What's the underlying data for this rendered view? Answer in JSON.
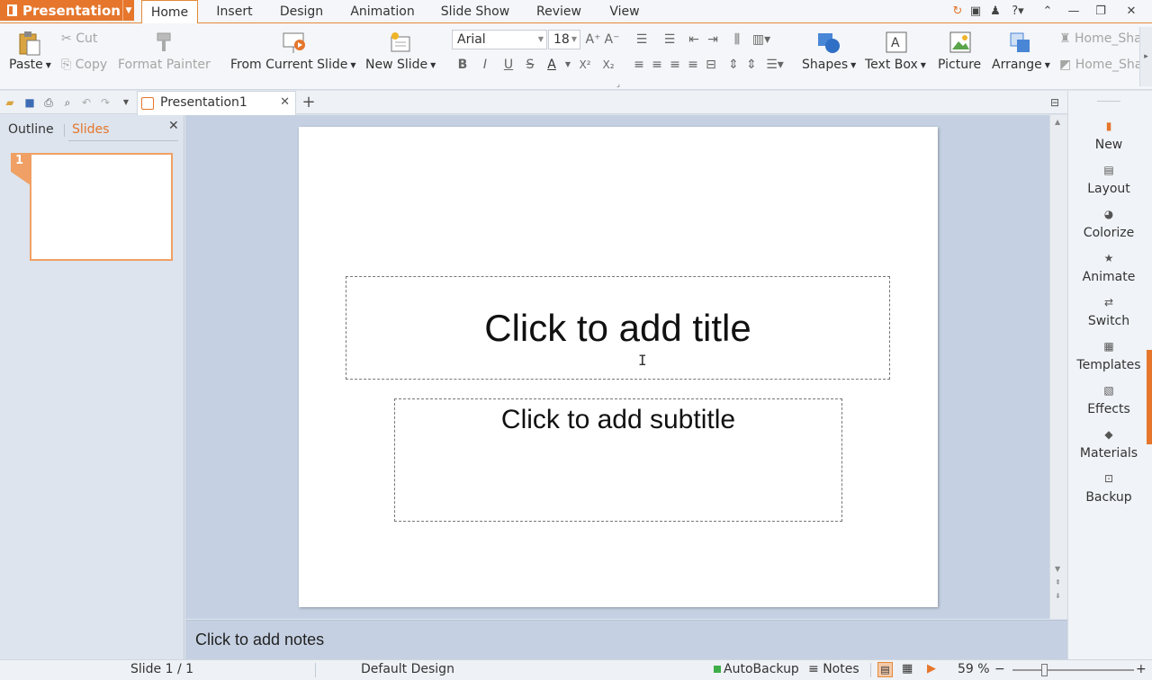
{
  "app": {
    "name": "Presentation",
    "brand_color": "#e5762c"
  },
  "menu": {
    "tabs": [
      "Home",
      "Insert",
      "Design",
      "Animation",
      "Slide Show",
      "Review",
      "View"
    ],
    "active_tab": "Home"
  },
  "ribbon": {
    "paste": "Paste",
    "cut": "Cut",
    "copy": "Copy",
    "format_painter": "Format Painter",
    "from_current_slide": "From Current Slide",
    "new_slide": "New Slide",
    "font_name": "Arial",
    "font_size": "18",
    "bold": "B",
    "italic": "I",
    "underline": "U",
    "strike": "S",
    "font_color": "A",
    "superscript": "X²",
    "subscript": "X₂",
    "shapes": "Shapes",
    "text_box": "Text Box",
    "picture": "Picture",
    "arrange": "Arrange",
    "home_share_1": "Home_Sha",
    "home_share_2": "Home_Sha"
  },
  "document": {
    "tab_name": "Presentation1",
    "new_tab_symbol": "+"
  },
  "left_pane": {
    "tabs": [
      "Outline",
      "Slides"
    ],
    "active_tab": "Slides",
    "slide_number": "1"
  },
  "slide": {
    "title_placeholder": "Click to add title",
    "subtitle_placeholder": "Click to add subtitle",
    "notes_placeholder": "Click to add notes"
  },
  "right_pane": {
    "items": [
      {
        "label": "New",
        "icon": "new-file-icon"
      },
      {
        "label": "Layout",
        "icon": "layout-icon"
      },
      {
        "label": "Colorize",
        "icon": "palette-icon"
      },
      {
        "label": "Animate",
        "icon": "animate-icon"
      },
      {
        "label": "Switch",
        "icon": "switch-icon"
      },
      {
        "label": "Templates",
        "icon": "templates-icon"
      },
      {
        "label": "Effects",
        "icon": "effects-icon"
      },
      {
        "label": "Materials",
        "icon": "materials-icon"
      },
      {
        "label": "Backup",
        "icon": "backup-icon"
      }
    ]
  },
  "status_bar": {
    "slide_info": "Slide 1 / 1",
    "design": "Default Design",
    "autobackup": "AutoBackup",
    "notes": "Notes",
    "zoom": "59 %",
    "zoom_minus": "−",
    "zoom_plus": "+"
  }
}
